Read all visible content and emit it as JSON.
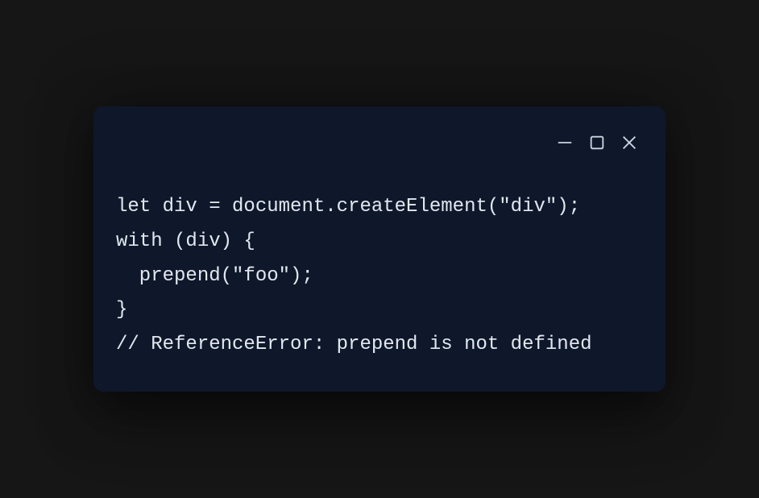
{
  "code": {
    "line1": "let div = document.createElement(\"div\");",
    "line2": "",
    "line3": "with (div) {",
    "line4": "  prepend(\"foo\");",
    "line5": "}",
    "line6": "// ReferenceError: prepend is not defined"
  }
}
